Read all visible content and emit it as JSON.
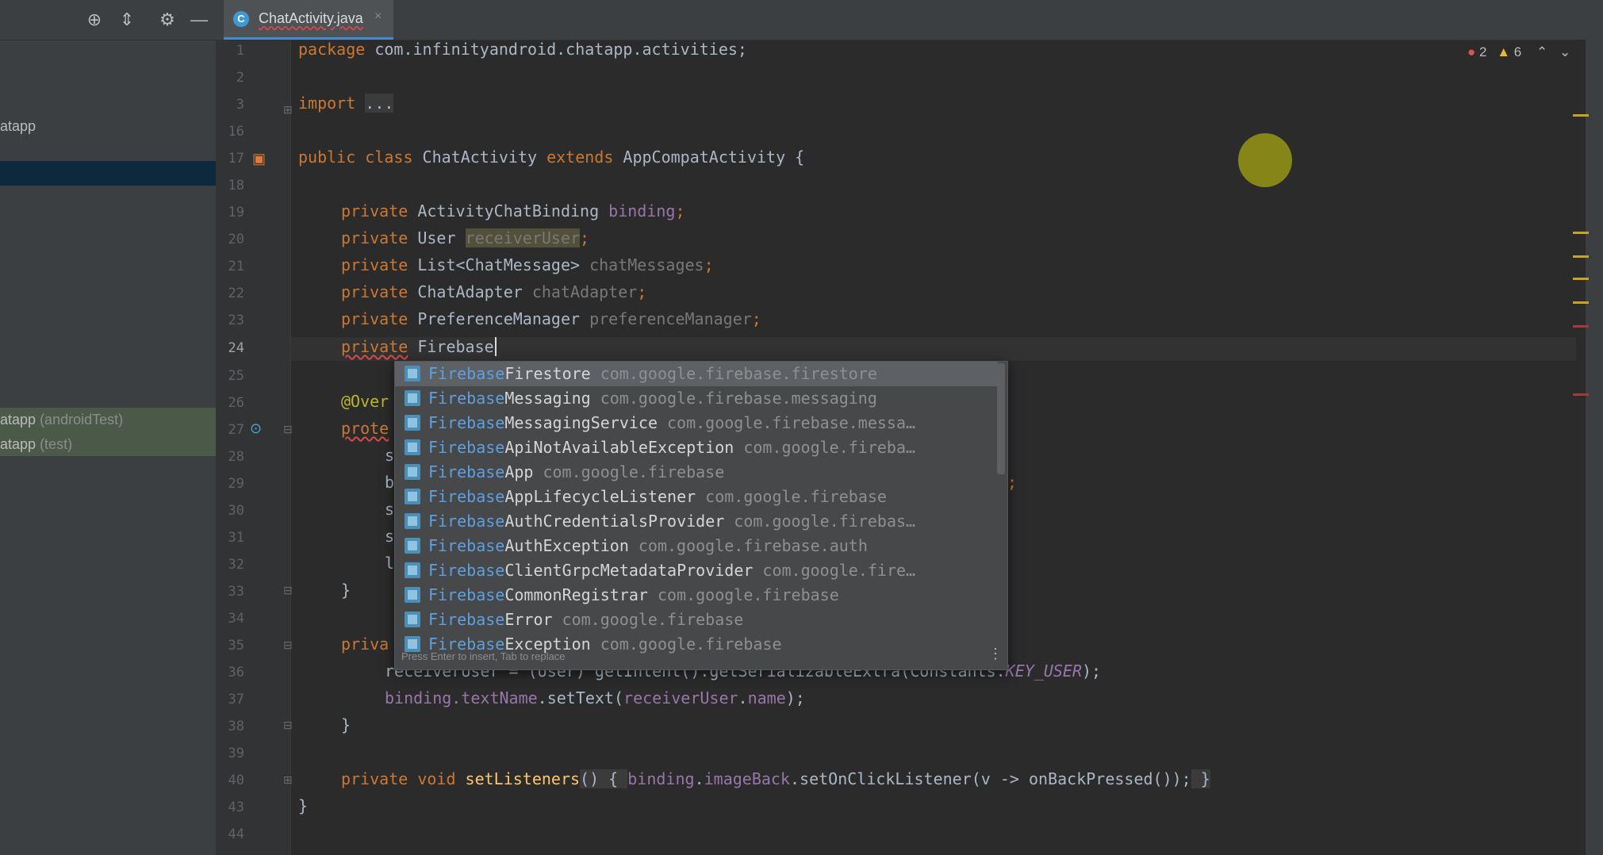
{
  "project_tree": {
    "item1": "atapp",
    "item2_main": "atapp",
    "item2_suffix": "(androidTest)",
    "item3_main": "atapp",
    "item3_suffix": "(test)"
  },
  "tab": {
    "label": "ChatActivity.java",
    "close": "×",
    "icon": "C"
  },
  "inspections": {
    "errors": "2",
    "warnings": "6"
  },
  "line_numbers": [
    "1",
    "2",
    "3",
    "16",
    "17",
    "18",
    "19",
    "20",
    "21",
    "22",
    "23",
    "24",
    "25",
    "26",
    "27",
    "28",
    "29",
    "30",
    "31",
    "32",
    "33",
    "34",
    "35",
    "36",
    "37",
    "38",
    "39",
    "40",
    "43",
    "44"
  ],
  "code": {
    "l1_kw": "package",
    "l1_rest": " com.infinityandroid.chatapp.activities;",
    "l3_kw": "import",
    "l3_fold": "...",
    "l17_kw1": "public class",
    "l17_name": " ChatActivity ",
    "l17_kw2": "extends",
    "l17_rest": " AppCompatActivity {",
    "l19_kw": "private",
    "l19_type": " ActivityChatBinding ",
    "l19_field": "binding",
    "l19_end": ";",
    "l20_kw": "private",
    "l20_type": " User ",
    "l20_field": "receiverUser",
    "l20_end": ";",
    "l21_kw": "private",
    "l21_type": " List<ChatMessage> ",
    "l21_field": "chatMessages",
    "l21_end": ";",
    "l22_kw": "private",
    "l22_type": " ChatAdapter ",
    "l22_field": "chatAdapter",
    "l22_end": ";",
    "l23_kw": "private",
    "l23_type": " PreferenceManager ",
    "l23_field": "preferenceManager",
    "l23_end": ";",
    "l24_kw": "private",
    "l24_type": " Firebase",
    "l26_ann": "@Over",
    "l27_kw": "prote",
    "l28": "s",
    "l29": "b",
    "l29_end": ";",
    "l30": "s",
    "l31": "s",
    "l32": "l",
    "l33": "}",
    "l35_kw": "priva",
    "l36_a": "receiverUser = (User) getIntent().getSerializableExtra(Constants.",
    "l36_const": "KEY_USER",
    "l36_end": ");",
    "l37_a": "binding.",
    "l37_field": "textName",
    "l37_b": ".setText(",
    "l37_field2": "receiverUser",
    "l37_c": ".",
    "l37_field3": "name",
    "l37_end": ");",
    "l38": "}",
    "l40_kw": "private void",
    "l40_method": " setListeners",
    "l40_paren": "()",
    "l40_brace": " { ",
    "l40_body1": "binding",
    "l40_body2": ".",
    "l40_body3": "imageBack",
    "l40_body4": ".setOnClickListener(v -> onBackPressed());",
    "l40_close": " }",
    "l43": "}"
  },
  "completion": {
    "prefix": "Firebase",
    "items": [
      {
        "rest": "Firestore",
        "pkg": "com.google.firebase.firestore"
      },
      {
        "rest": "Messaging",
        "pkg": "com.google.firebase.messaging"
      },
      {
        "rest": "MessagingService",
        "pkg": "com.google.firebase.messa…"
      },
      {
        "rest": "ApiNotAvailableException",
        "pkg": "com.google.fireba…"
      },
      {
        "rest": "App",
        "pkg": "com.google.firebase"
      },
      {
        "rest": "AppLifecycleListener",
        "pkg": "com.google.firebase"
      },
      {
        "rest": "AuthCredentialsProvider",
        "pkg": "com.google.firebas…"
      },
      {
        "rest": "AuthException",
        "pkg": "com.google.firebase.auth"
      },
      {
        "rest": "ClientGrpcMetadataProvider",
        "pkg": "com.google.fire…"
      },
      {
        "rest": "CommonRegistrar",
        "pkg": "com.google.firebase"
      },
      {
        "rest": "Error",
        "pkg": "com.google.firebase"
      },
      {
        "rest": "Exception",
        "pkg": "com.google.firebase"
      }
    ],
    "hint": "Press Enter to insert, Tab to replace",
    "more": "⋮"
  }
}
